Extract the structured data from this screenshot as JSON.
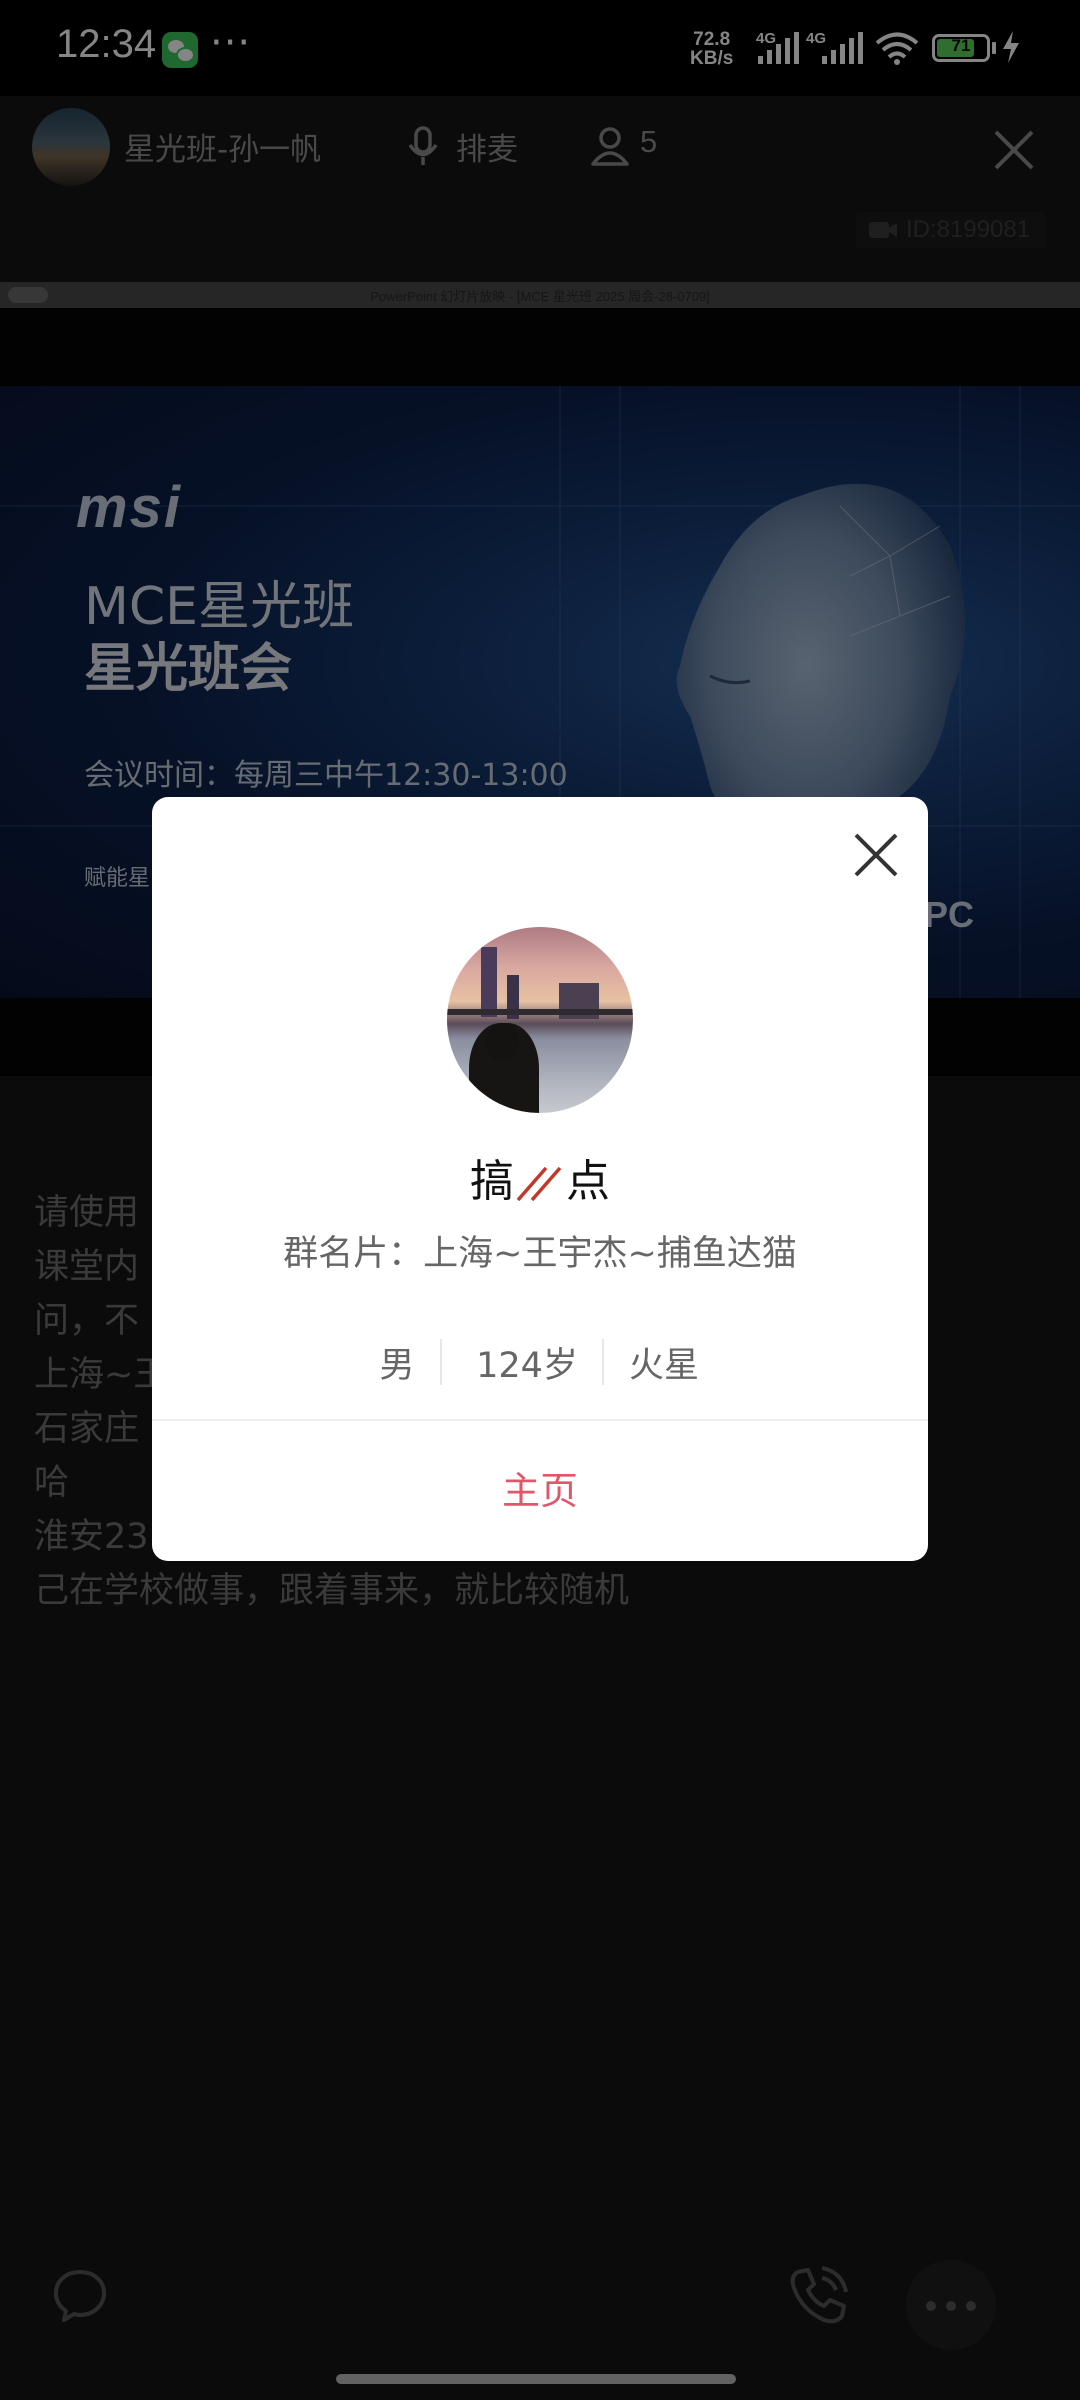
{
  "status_bar": {
    "time": "12:34",
    "dots": "···",
    "speed_value": "72.8",
    "speed_unit": "KB/s",
    "net1": "4G",
    "net2": "4G",
    "battery": "71",
    "icons": [
      "wechat-icon",
      "signal-icon",
      "wifi-icon",
      "battery-icon",
      "charging-icon"
    ]
  },
  "room": {
    "name": "星光班-孙一帆",
    "mic_label": "排麦",
    "participant_count": "5",
    "meeting_id": "ID:8199081"
  },
  "share": {
    "window_title": "PowerPoint 幻灯片放映 - [MCE 星光班 2025 周会-28-0709]",
    "slide": {
      "logo": "msi",
      "title1": "MCE星光班",
      "title2": "星光班会",
      "meeting_time": "会议时间：每周三中午12:30-13:00",
      "footer": "赋能星",
      "brand": "I PC"
    }
  },
  "chat": {
    "lines": [
      "请使用",
      "课堂内",
      "问，不",
      "上海~王",
      "石家庄",
      "哈",
      "淮安23",
      "己在学校做事，跟着事来，就比较随机"
    ]
  },
  "profile_modal": {
    "nickname_left": "搞",
    "nickname_right": "点",
    "group_card": "群名片：上海~王宇杰~捕鱼达猫",
    "gender": "男",
    "age": "124岁",
    "location": "火星",
    "homepage_label": "主页",
    "accent": "#e0576a"
  },
  "bottom_bar": {
    "icons": [
      "chat-bubble-icon",
      "phone-call-icon",
      "more-icon"
    ]
  }
}
